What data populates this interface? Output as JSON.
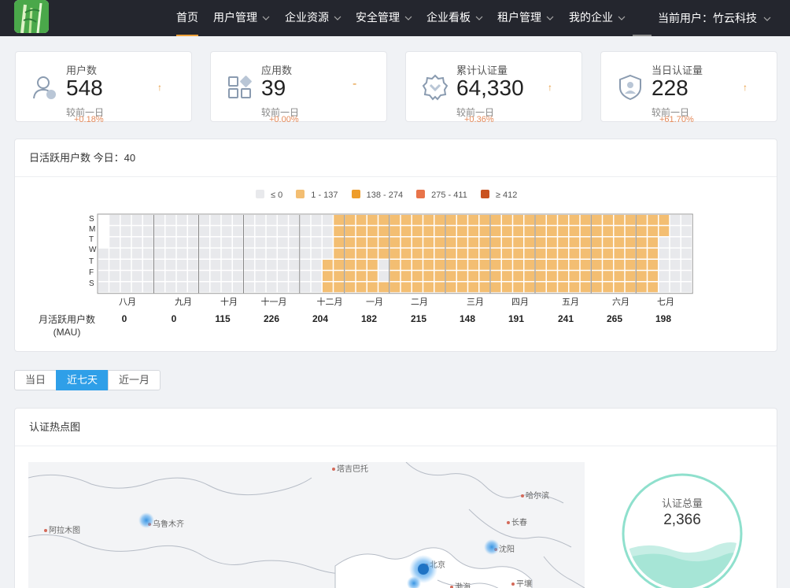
{
  "nav": {
    "items": [
      {
        "label": "首页",
        "active": true,
        "dropdown": false
      },
      {
        "label": "用户管理",
        "dropdown": true
      },
      {
        "label": "企业资源",
        "dropdown": true
      },
      {
        "label": "安全管理",
        "dropdown": true
      },
      {
        "label": "企业看板",
        "dropdown": true
      },
      {
        "label": "租户管理",
        "dropdown": true
      },
      {
        "label": "我的企业",
        "dropdown": true
      }
    ],
    "current_user": "当前用户：竹云科技"
  },
  "stats": [
    {
      "label": "用户数",
      "value": "548",
      "compare": "较前一日",
      "change": "+0.18%",
      "trend": "up",
      "icon": "user-icon"
    },
    {
      "label": "应用数",
      "value": "39",
      "compare": "较前一日",
      "change": "+0.00%",
      "trend": "flat",
      "icon": "apps-icon"
    },
    {
      "label": "累计认证量",
      "value": "64,330",
      "compare": "较前一日",
      "change": "+0.36%",
      "trend": "up",
      "icon": "verified-badge-icon"
    },
    {
      "label": "当日认证量",
      "value": "228",
      "compare": "较前一日",
      "change": "+61.70%",
      "trend": "up",
      "icon": "shield-user-icon"
    }
  ],
  "activity": {
    "title": "日活跃用户数 今日：40",
    "legend": [
      {
        "label": "≤ 0",
        "color": "#e8e9ec"
      },
      {
        "label": "1 - 137",
        "color": "#f3be72"
      },
      {
        "label": "138 - 274",
        "color": "#ee9d2b"
      },
      {
        "label": "275 - 411",
        "color": "#e8744a"
      },
      {
        "label": "≥ 412",
        "color": "#c9521f"
      }
    ],
    "day_labels": [
      "S",
      "M",
      "T",
      "W",
      "T",
      "F",
      "S"
    ],
    "months": [
      "八月",
      "九月",
      "十月",
      "十一月",
      "十二月",
      "一月",
      "二月",
      "三月",
      "四月",
      "五月",
      "六月",
      "七月"
    ],
    "mau_label_line1": "月活跃用户数",
    "mau_label_line2": "(MAU)",
    "mau_values": [
      "0",
      "0",
      "115",
      "226",
      "204",
      "182",
      "215",
      "148",
      "191",
      "241",
      "265",
      "198"
    ]
  },
  "range": {
    "options": [
      {
        "label": "当日",
        "active": false
      },
      {
        "label": "近七天",
        "active": true
      },
      {
        "label": "近一月",
        "active": false
      }
    ]
  },
  "auth_map": {
    "title": "认证热点图",
    "cities": [
      "塔吉巴托",
      "哈尔滨",
      "乌鲁木齐",
      "长春",
      "阿拉木图",
      "沈阳",
      "北京",
      "渤海",
      "平壤"
    ],
    "total_label": "认证总量",
    "total_value": "2,366"
  }
}
